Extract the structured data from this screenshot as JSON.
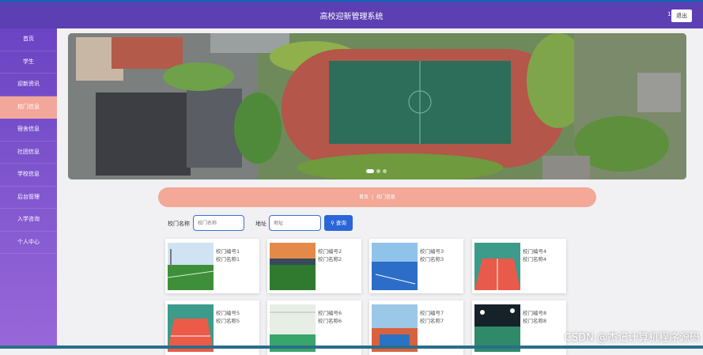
{
  "app": {
    "title": "高校迎新管理系统",
    "user": "11",
    "logout_label": "退出"
  },
  "sidebar": {
    "items": [
      {
        "label": "首页"
      },
      {
        "label": "学生"
      },
      {
        "label": "迎新资讯"
      },
      {
        "label": "校门信息",
        "active": true
      },
      {
        "label": "宿舍信息"
      },
      {
        "label": "社团信息"
      },
      {
        "label": "学校信息"
      },
      {
        "label": "后台管理"
      },
      {
        "label": "入学咨询"
      },
      {
        "label": "个人中心"
      }
    ]
  },
  "breadcrumb": {
    "home": "首页",
    "separator": "|",
    "current": "校门信息"
  },
  "search": {
    "name_label": "校门名称",
    "name_placeholder": "校门名称",
    "address_label": "地址",
    "address_placeholder": "地址",
    "button_label": "查询"
  },
  "cards": [
    {
      "code": "校门编号1",
      "name": "校门名称1",
      "image": "soccer-field"
    },
    {
      "code": "校门编号2",
      "name": "校门名称2",
      "image": "sunset-field"
    },
    {
      "code": "校门编号3",
      "name": "校门名称3",
      "image": "blue-court"
    },
    {
      "code": "校门编号4",
      "name": "校门名称4",
      "image": "red-court"
    },
    {
      "code": "校门编号5",
      "name": "校门名称5",
      "image": "red-court"
    },
    {
      "code": "校门编号6",
      "name": "校门名称6",
      "image": "indoor-court"
    },
    {
      "code": "校门编号7",
      "name": "校门名称7",
      "image": "blue-court"
    },
    {
      "code": "校门编号8",
      "name": "校门名称8",
      "image": "night-court"
    }
  ],
  "watermark": "CSDN @杰记计算机程序源码",
  "colors": {
    "header": "#5c3fb3",
    "active_menu": "#f2a79a",
    "breadcrumb": "#f3a898",
    "button": "#2b66d8"
  }
}
